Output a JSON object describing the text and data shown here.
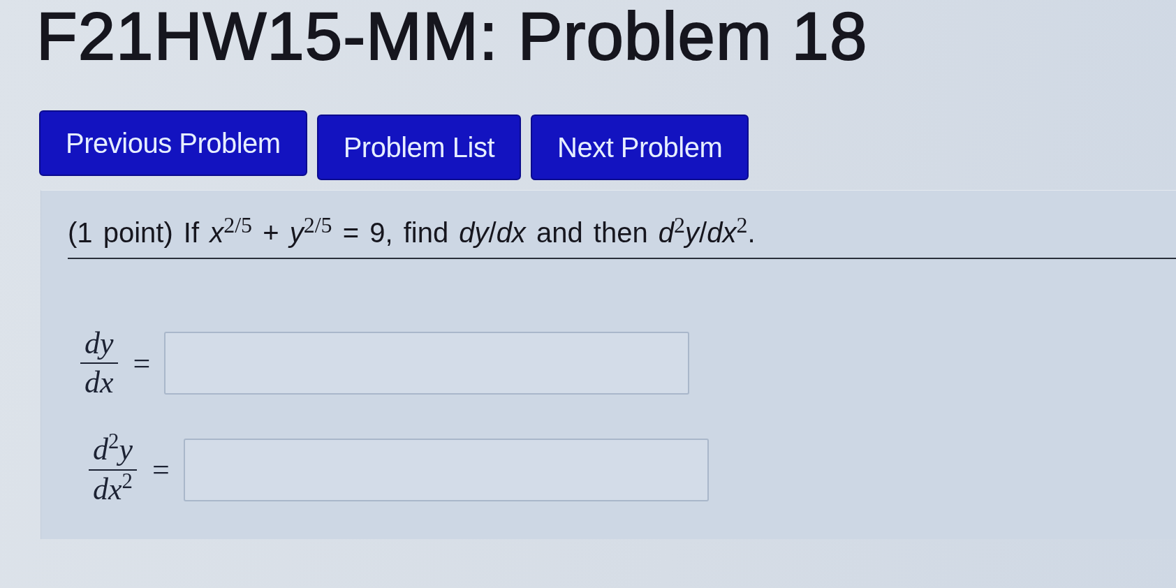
{
  "page_title": "F21HW15-MM: Problem 18",
  "nav_buttons": [
    {
      "label": "Previous Problem"
    },
    {
      "label": "Problem List"
    },
    {
      "label": "Next Problem"
    }
  ],
  "problem": {
    "statement": "(1 point) If *x*$^{2/5}$ + *y*$^{2/5}$ = 9, find *dy*/*dx* and then *d*$^{2}$*y*/*dx*$^{2}$.",
    "answers": [
      {
        "numerator": "dy",
        "denominator": "dx",
        "relation": "="
      },
      {
        "numerator": "d$^{2}$y",
        "denominator": "dx$^{2}$",
        "relation": "="
      }
    ]
  }
}
